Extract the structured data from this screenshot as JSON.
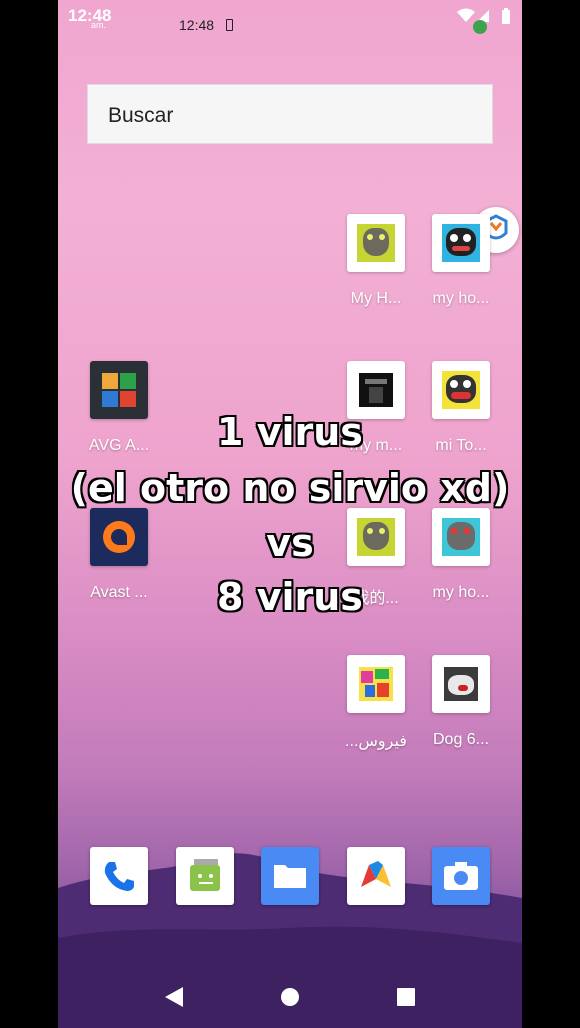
{
  "status_bar": {
    "time": "12:48",
    "ampm": "am.",
    "time_secondary": "12:48"
  },
  "search": {
    "placeholder": "Buscar"
  },
  "home_apps": [
    {
      "label": "My H...",
      "icon": "talking-tom-icon"
    },
    {
      "label": "my ho...",
      "icon": "tom-cat-blue-icon"
    },
    {
      "label": "AVG A...",
      "icon": "avg-antivirus-icon"
    },
    {
      "label": "my m...",
      "icon": "dark-figure-icon"
    },
    {
      "label": "mi To...",
      "icon": "tom-cat-yellow-icon"
    },
    {
      "label": "Avast ...",
      "icon": "avast-antivirus-icon"
    },
    {
      "label": "我的...",
      "icon": "talking-tom-icon"
    },
    {
      "label": "my ho...",
      "icon": "tom-cat-teal-icon"
    },
    {
      "label": "...فيروس",
      "icon": "colorful-pixel-icon"
    },
    {
      "label": "Dog 6...",
      "icon": "dog-photo-icon"
    }
  ],
  "dock": [
    {
      "icon": "phone-icon"
    },
    {
      "icon": "messages-icon"
    },
    {
      "icon": "files-icon"
    },
    {
      "icon": "vlc-like-icon"
    },
    {
      "icon": "camera-icon"
    }
  ],
  "overlay_text": {
    "line1": "1 virus",
    "line2": "(el otro no sirvio xd)",
    "line3": "vs",
    "line4": "8 virus"
  },
  "navigation": {
    "back": "back-icon",
    "home": "home-icon",
    "recents": "recents-icon"
  }
}
